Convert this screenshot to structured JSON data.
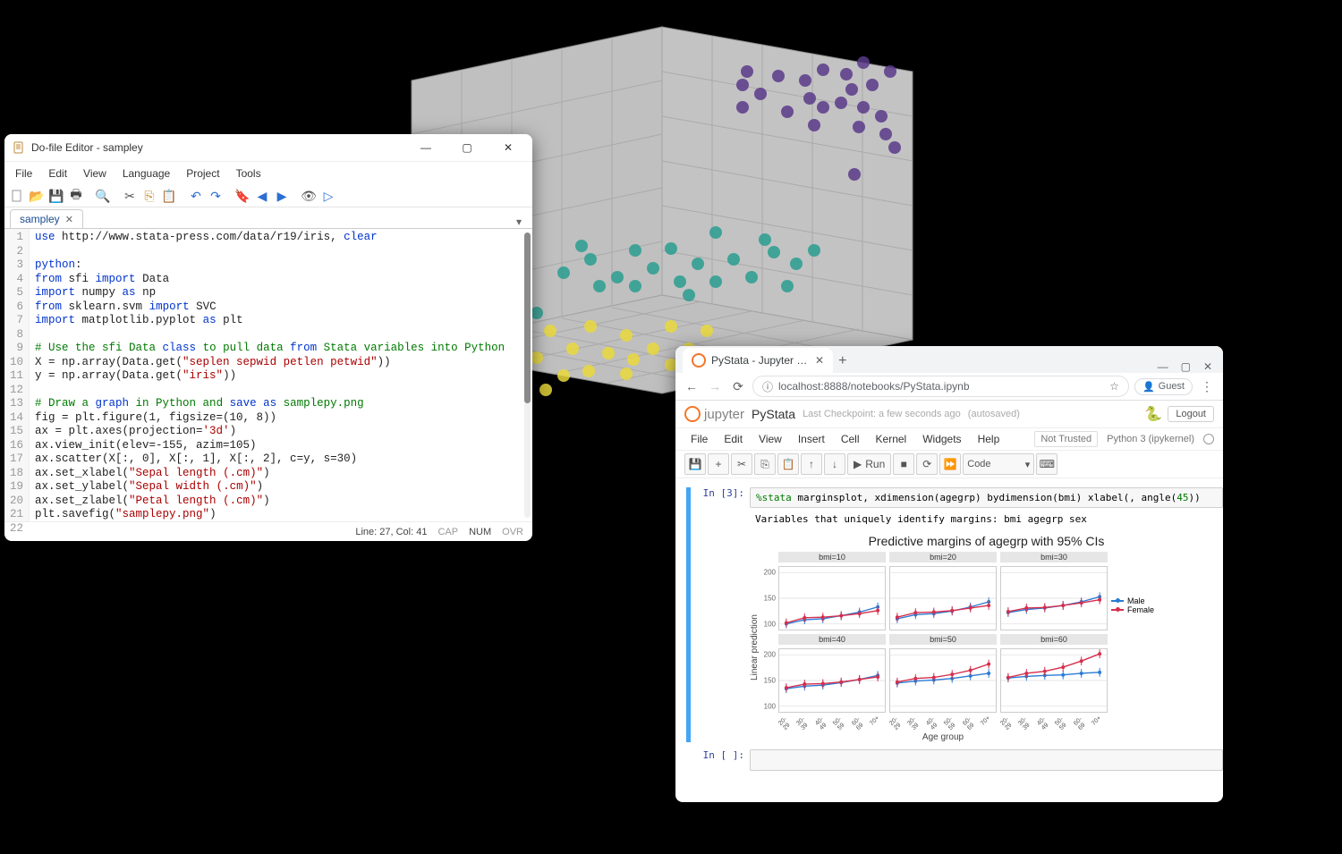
{
  "do_editor": {
    "title": "Do-file Editor - sampley",
    "menus": [
      "File",
      "Edit",
      "View",
      "Language",
      "Project",
      "Tools"
    ],
    "tab": "sampley",
    "status_line": "Line: 27, Col: 41",
    "status_caps": "CAP",
    "status_num": "NUM",
    "status_ovr": "OVR",
    "code_lines": [
      {
        "n": "1",
        "tokens": [
          {
            "t": "use",
            "c": "kw"
          },
          {
            "t": " http://www.stata-press.com/data/r19/iris, "
          },
          {
            "t": "clear",
            "c": "kw"
          }
        ]
      },
      {
        "n": "2",
        "tokens": []
      },
      {
        "n": "3",
        "tokens": [
          {
            "t": "python",
            "c": "kw"
          },
          {
            "t": ":"
          }
        ]
      },
      {
        "n": "4",
        "tokens": [
          {
            "t": "from",
            "c": "kw"
          },
          {
            "t": " sfi "
          },
          {
            "t": "import",
            "c": "kw"
          },
          {
            "t": " Data"
          }
        ]
      },
      {
        "n": "5",
        "tokens": [
          {
            "t": "import",
            "c": "kw"
          },
          {
            "t": " numpy "
          },
          {
            "t": "as",
            "c": "kw"
          },
          {
            "t": " np"
          }
        ]
      },
      {
        "n": "6",
        "tokens": [
          {
            "t": "from",
            "c": "kw"
          },
          {
            "t": " sklearn.svm "
          },
          {
            "t": "import",
            "c": "kw"
          },
          {
            "t": " SVC"
          }
        ]
      },
      {
        "n": "7",
        "tokens": [
          {
            "t": "import",
            "c": "kw"
          },
          {
            "t": " matplotlib.pyplot "
          },
          {
            "t": "as",
            "c": "kw"
          },
          {
            "t": " plt"
          }
        ]
      },
      {
        "n": "8",
        "tokens": []
      },
      {
        "n": "9",
        "tokens": [
          {
            "t": "# Use the sfi Data ",
            "c": "cmt"
          },
          {
            "t": "class",
            "c": "kw"
          },
          {
            "t": " to pull data ",
            "c": "cmt"
          },
          {
            "t": "from",
            "c": "kw"
          },
          {
            "t": " Stata variables into Python",
            "c": "cmt"
          }
        ]
      },
      {
        "n": "10",
        "tokens": [
          {
            "t": "X = np.array(Data.get("
          },
          {
            "t": "\"seplen sepwid petlen petwid\"",
            "c": "str"
          },
          {
            "t": "))"
          }
        ]
      },
      {
        "n": "11",
        "tokens": [
          {
            "t": "y = np.array(Data.get("
          },
          {
            "t": "\"iris\"",
            "c": "str"
          },
          {
            "t": "))"
          }
        ]
      },
      {
        "n": "12",
        "tokens": []
      },
      {
        "n": "13",
        "tokens": [
          {
            "t": "# Draw a ",
            "c": "cmt"
          },
          {
            "t": "graph",
            "c": "kw"
          },
          {
            "t": " in Python and ",
            "c": "cmt"
          },
          {
            "t": "save",
            "c": "kw"
          },
          {
            "t": " ",
            "c": "cmt"
          },
          {
            "t": "as",
            "c": "kw"
          },
          {
            "t": " samplepy.png",
            "c": "cmt"
          }
        ]
      },
      {
        "n": "14",
        "tokens": [
          {
            "t": "fig = plt.figure(1, figsize=(10, 8))"
          }
        ]
      },
      {
        "n": "15",
        "tokens": [
          {
            "t": "ax = plt.axes(projection="
          },
          {
            "t": "'3d'",
            "c": "str"
          },
          {
            "t": ")"
          }
        ]
      },
      {
        "n": "16",
        "tokens": [
          {
            "t": "ax.view_init(elev=-155, azim=105)"
          }
        ]
      },
      {
        "n": "17",
        "tokens": [
          {
            "t": "ax.scatter(X[:, 0], X[:, 1], X[:, 2], c=y, s=30)"
          }
        ]
      },
      {
        "n": "18",
        "tokens": [
          {
            "t": "ax.set_xlabel("
          },
          {
            "t": "\"Sepal length (.cm)\"",
            "c": "str"
          },
          {
            "t": ")"
          }
        ]
      },
      {
        "n": "19",
        "tokens": [
          {
            "t": "ax.set_ylabel("
          },
          {
            "t": "\"Sepal width (.cm)\"",
            "c": "str"
          },
          {
            "t": ")"
          }
        ]
      },
      {
        "n": "20",
        "tokens": [
          {
            "t": "ax.set_zlabel("
          },
          {
            "t": "\"Petal length (.cm)\"",
            "c": "str"
          },
          {
            "t": ")"
          }
        ]
      },
      {
        "n": "21",
        "tokens": [
          {
            "t": "plt.savefig("
          },
          {
            "t": "\"samplepy.png\"",
            "c": "str"
          },
          {
            "t": ")"
          }
        ]
      },
      {
        "n": "22",
        "tokens": []
      }
    ]
  },
  "jupyter": {
    "browser_tab": "PyStata - Jupyter Notebook",
    "url_display": "localhost:8888/notebooks/PyStata.ipynb",
    "guest": "Guest",
    "logo": "jupyter",
    "nbname": "PyStata",
    "checkpoint": "Last Checkpoint: a few seconds ago",
    "autosaved": "(autosaved)",
    "logout": "Logout",
    "menus": [
      "File",
      "Edit",
      "View",
      "Insert",
      "Cell",
      "Kernel",
      "Widgets",
      "Help"
    ],
    "not_trusted": "Not Trusted",
    "kernel": "Python 3 (ipykernel)",
    "run_label": "Run",
    "cell_type": "Code",
    "in_label_3": "In [3]:",
    "in_label_blank": "In [ ]:",
    "code3": "%stata marginsplot, xdimension(agegrp) bydimension(bmi) xlabel(, angle(45))",
    "out_vars": "Variables that uniquely identify margins: bmi agegrp sex"
  },
  "chart_data": {
    "type": "line",
    "title": "Predictive margins of agegrp with 95% CIs",
    "xlabel": "Age group",
    "ylabel": "Linear prediction",
    "categories": [
      "20-29",
      "30-39",
      "40-49",
      "50-59",
      "60-69",
      "70+"
    ],
    "panels": [
      "bmi=10",
      "bmi=20",
      "bmi=30",
      "bmi=40",
      "bmi=50",
      "bmi=60"
    ],
    "yticks_top": [
      100,
      150,
      200
    ],
    "yticks_bottom": [
      100,
      150,
      200
    ],
    "ylim": [
      90,
      210
    ],
    "legend": [
      "Male",
      "Female"
    ],
    "series": [
      {
        "panel": "bmi=10",
        "name": "Male",
        "values": [
          100,
          108,
          110,
          116,
          123,
          133
        ]
      },
      {
        "panel": "bmi=10",
        "name": "Female",
        "values": [
          102,
          112,
          113,
          116,
          120,
          126
        ]
      },
      {
        "panel": "bmi=20",
        "name": "Male",
        "values": [
          110,
          118,
          120,
          125,
          133,
          143
        ]
      },
      {
        "panel": "bmi=20",
        "name": "Female",
        "values": [
          113,
          122,
          123,
          126,
          131,
          136
        ]
      },
      {
        "panel": "bmi=30",
        "name": "Male",
        "values": [
          122,
          128,
          131,
          136,
          143,
          153
        ]
      },
      {
        "panel": "bmi=30",
        "name": "Female",
        "values": [
          124,
          131,
          132,
          136,
          141,
          147
        ]
      },
      {
        "panel": "bmi=40",
        "name": "Male",
        "values": [
          134,
          139,
          141,
          146,
          152,
          160
        ]
      },
      {
        "panel": "bmi=40",
        "name": "Female",
        "values": [
          136,
          143,
          144,
          147,
          152,
          157
        ]
      },
      {
        "panel": "bmi=50",
        "name": "Male",
        "values": [
          145,
          149,
          151,
          154,
          159,
          164
        ]
      },
      {
        "panel": "bmi=50",
        "name": "Female",
        "values": [
          147,
          154,
          156,
          162,
          170,
          182
        ]
      },
      {
        "panel": "bmi=60",
        "name": "Male",
        "values": [
          155,
          158,
          160,
          161,
          164,
          166
        ]
      },
      {
        "panel": "bmi=60",
        "name": "Female",
        "values": [
          156,
          164,
          168,
          176,
          188,
          202
        ]
      }
    ]
  },
  "scatter3d": {
    "clusters": [
      {
        "color": "#5b3a8a",
        "points": [
          [
            435,
            60
          ],
          [
            470,
            65
          ],
          [
            500,
            70
          ],
          [
            520,
            58
          ],
          [
            505,
            90
          ],
          [
            540,
            95
          ],
          [
            552,
            80
          ],
          [
            565,
            100
          ],
          [
            575,
            75
          ],
          [
            585,
            110
          ],
          [
            595,
            60
          ],
          [
            480,
            105
          ],
          [
            450,
            85
          ],
          [
            430,
            100
          ],
          [
            510,
            120
          ],
          [
            565,
            50
          ],
          [
            590,
            130
          ],
          [
            546,
            63
          ],
          [
            560,
            122
          ],
          [
            430,
            75
          ],
          [
            600,
            145
          ],
          [
            520,
            100
          ],
          [
            555,
            175
          ]
        ]
      },
      {
        "color": "#2a9d8f",
        "points": [
          [
            230,
            285
          ],
          [
            260,
            270
          ],
          [
            290,
            290
          ],
          [
            310,
            260
          ],
          [
            330,
            280
          ],
          [
            360,
            295
          ],
          [
            380,
            275
          ],
          [
            400,
            295
          ],
          [
            420,
            270
          ],
          [
            440,
            290
          ],
          [
            465,
            262
          ],
          [
            490,
            275
          ],
          [
            510,
            260
          ],
          [
            310,
            300
          ],
          [
            350,
            258
          ],
          [
            270,
            300
          ],
          [
            250,
            255
          ],
          [
            400,
            240
          ],
          [
            455,
            248
          ],
          [
            370,
            310
          ],
          [
            480,
            300
          ],
          [
            200,
            330
          ]
        ]
      },
      {
        "color": "#e9d83b",
        "points": [
          [
            150,
            370
          ],
          [
            180,
            360
          ],
          [
            200,
            380
          ],
          [
            215,
            350
          ],
          [
            240,
            370
          ],
          [
            260,
            345
          ],
          [
            280,
            375
          ],
          [
            300,
            355
          ],
          [
            330,
            370
          ],
          [
            350,
            345
          ],
          [
            370,
            370
          ],
          [
            390,
            350
          ],
          [
            120,
            410
          ],
          [
            170,
            400
          ],
          [
            230,
            400
          ],
          [
            300,
            398
          ],
          [
            350,
            388
          ],
          [
            400,
            378
          ],
          [
            210,
            416
          ],
          [
            258,
            395
          ],
          [
            308,
            382
          ]
        ]
      }
    ]
  }
}
